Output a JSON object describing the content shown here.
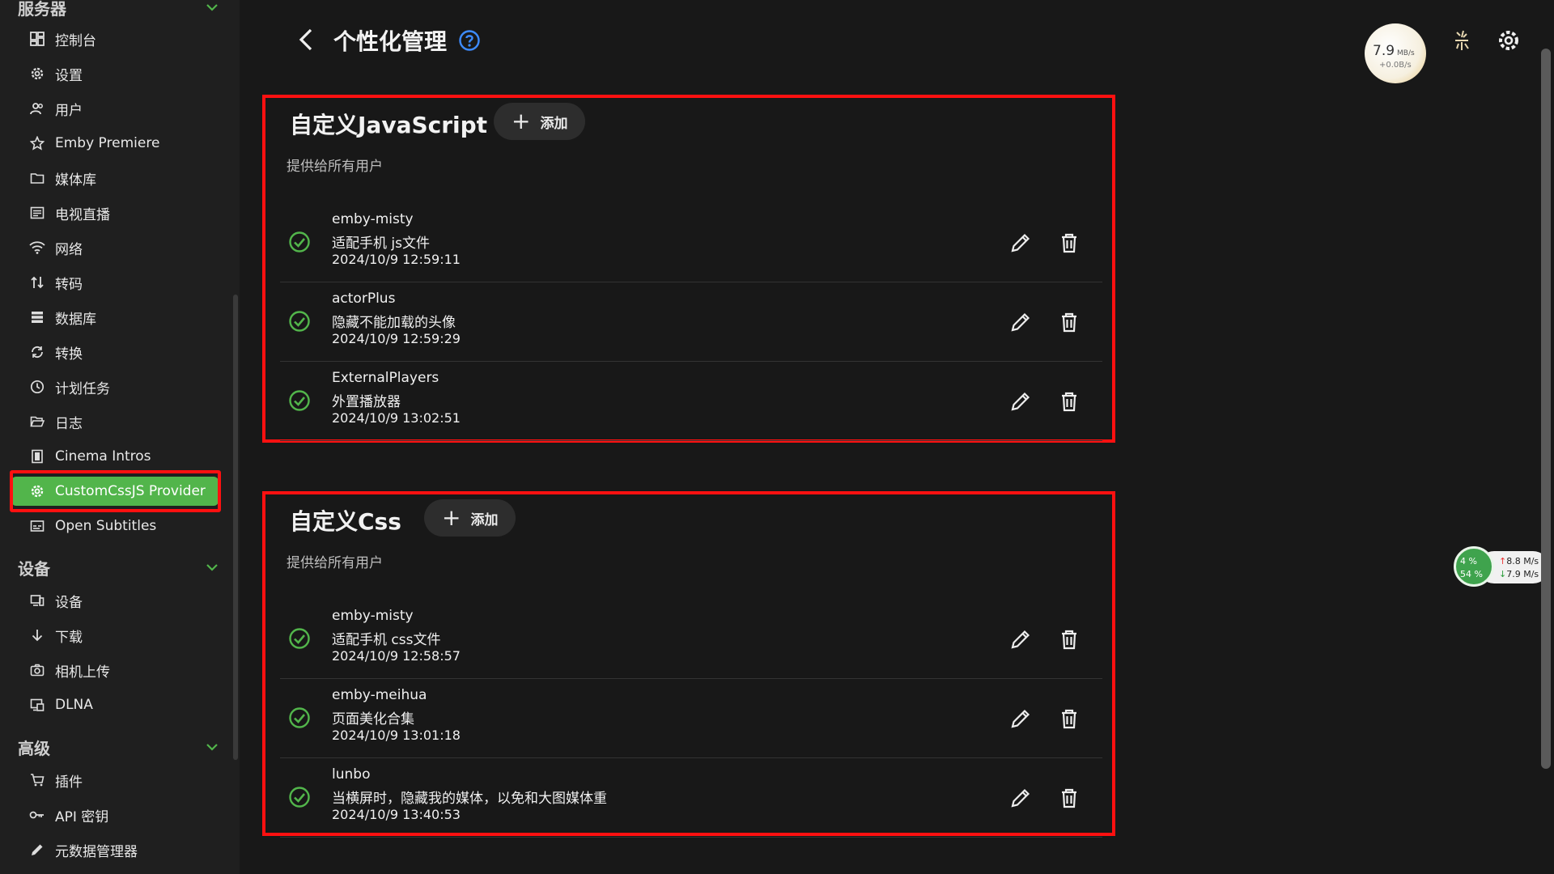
{
  "sidebar": {
    "sections": [
      {
        "title": "服务器",
        "items": [
          {
            "label": "控制台",
            "icon": "dashboard-icon"
          },
          {
            "label": "设置",
            "icon": "gear-icon"
          },
          {
            "label": "用户",
            "icon": "users-icon"
          },
          {
            "label": "Emby Premiere",
            "icon": "star-icon"
          },
          {
            "label": "媒体库",
            "icon": "folder-icon"
          },
          {
            "label": "电视直播",
            "icon": "tv-guide-icon"
          },
          {
            "label": "网络",
            "icon": "wifi-icon"
          },
          {
            "label": "转码",
            "icon": "transcode-icon"
          },
          {
            "label": "数据库",
            "icon": "database-icon"
          },
          {
            "label": "转换",
            "icon": "convert-icon"
          },
          {
            "label": "计划任务",
            "icon": "clock-icon"
          },
          {
            "label": "日志",
            "icon": "folder-open-icon"
          },
          {
            "label": "Cinema Intros",
            "icon": "film-icon"
          },
          {
            "label": "CustomCssJS Provider",
            "icon": "gear-icon",
            "active": true
          },
          {
            "label": "Open Subtitles",
            "icon": "subtitles-icon"
          }
        ]
      },
      {
        "title": "设备",
        "items": [
          {
            "label": "设备",
            "icon": "devices-icon"
          },
          {
            "label": "下载",
            "icon": "download-icon"
          },
          {
            "label": "相机上传",
            "icon": "camera-icon"
          },
          {
            "label": "DLNA",
            "icon": "dlna-icon"
          }
        ]
      },
      {
        "title": "高级",
        "items": [
          {
            "label": "插件",
            "icon": "cart-icon"
          },
          {
            "label": "API 密钥",
            "icon": "key-icon"
          },
          {
            "label": "元数据管理器",
            "icon": "pencil-icon"
          }
        ]
      }
    ]
  },
  "header": {
    "title": "个性化管理",
    "speed_value": "7.9",
    "speed_unit": "MB/s",
    "speed_sub": "+0.0B/s"
  },
  "net_widget": {
    "cpu": "4 %",
    "mem": "54 %",
    "up": "8.8 M/s",
    "down": "7.9 M/s"
  },
  "panels": [
    {
      "title": "自定义JavaScript",
      "add_label": "添加",
      "subtitle": "提供给所有用户",
      "items": [
        {
          "name": "emby-misty",
          "desc": "适配手机 js文件",
          "date": "2024/10/9 12:59:11"
        },
        {
          "name": "actorPlus",
          "desc": "隐藏不能加载的头像",
          "date": "2024/10/9 12:59:29"
        },
        {
          "name": "ExternalPlayers",
          "desc": "外置播放器",
          "date": "2024/10/9 13:02:51"
        }
      ]
    },
    {
      "title": "自定义Css",
      "add_label": "添加",
      "subtitle": "提供给所有用户",
      "items": [
        {
          "name": "emby-misty",
          "desc": "适配手机 css文件",
          "date": "2024/10/9 12:58:57"
        },
        {
          "name": "emby-meihua",
          "desc": "页面美化合集",
          "date": "2024/10/9 13:01:18"
        },
        {
          "name": "lunbo",
          "desc": "当横屏时，隐藏我的媒体，以免和大图媒体重",
          "date": "2024/10/9 13:40:53"
        }
      ]
    }
  ],
  "colors": {
    "accent_green": "#52b54b",
    "highlight_red": "#ff1010",
    "help_blue": "#3d8bff"
  }
}
